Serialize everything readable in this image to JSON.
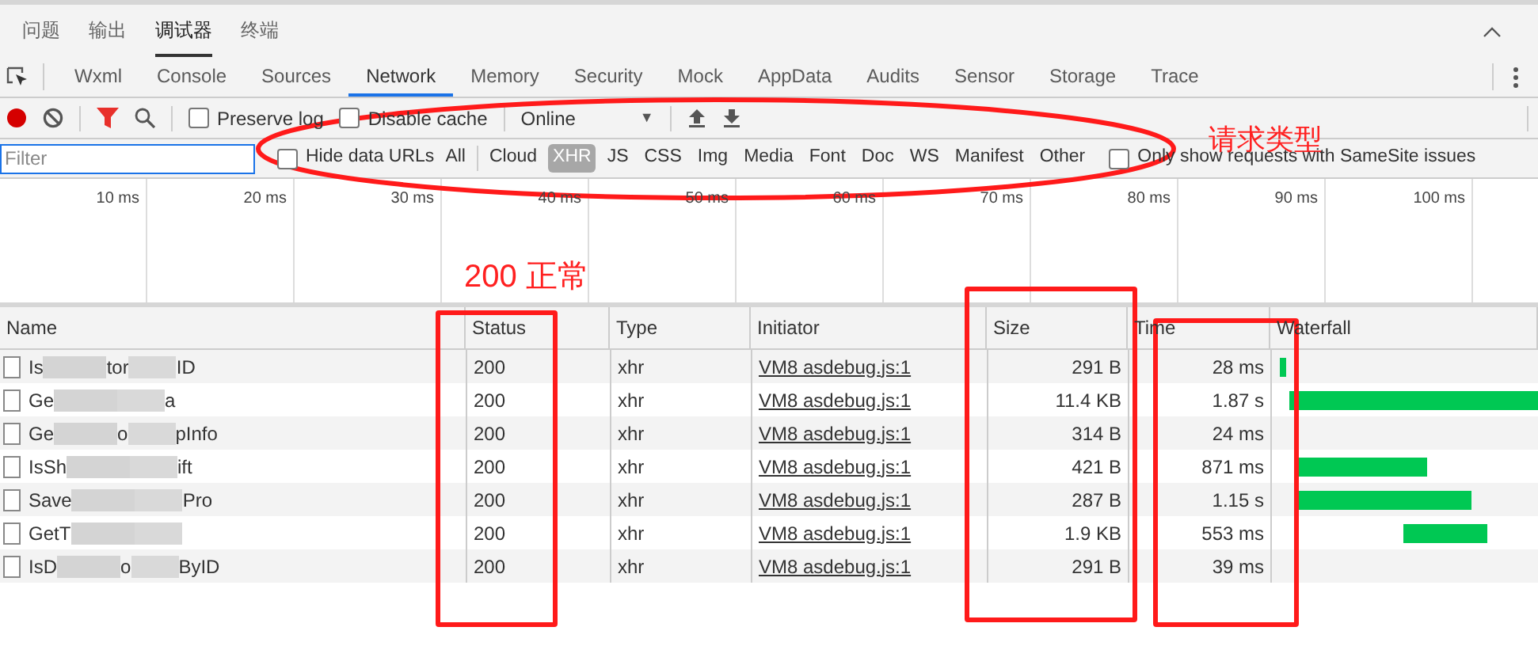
{
  "panel_tabs": [
    {
      "label": "问题",
      "selected": false
    },
    {
      "label": "输出",
      "selected": false
    },
    {
      "label": "调试器",
      "selected": true
    },
    {
      "label": "终端",
      "selected": false
    }
  ],
  "devtools_tabs": [
    {
      "label": "Wxml",
      "selected": false
    },
    {
      "label": "Console",
      "selected": false
    },
    {
      "label": "Sources",
      "selected": false
    },
    {
      "label": "Network",
      "selected": true
    },
    {
      "label": "Memory",
      "selected": false
    },
    {
      "label": "Security",
      "selected": false
    },
    {
      "label": "Mock",
      "selected": false
    },
    {
      "label": "AppData",
      "selected": false
    },
    {
      "label": "Audits",
      "selected": false
    },
    {
      "label": "Sensor",
      "selected": false
    },
    {
      "label": "Storage",
      "selected": false
    },
    {
      "label": "Trace",
      "selected": false
    }
  ],
  "toolbar": {
    "preserve_log": {
      "label": "Preserve log",
      "checked": false
    },
    "disable_cache": {
      "label": "Disable cache",
      "checked": false
    },
    "throttling": "Online",
    "throttling_caret": "▼"
  },
  "filter_bar": {
    "placeholder": "Filter",
    "hide_data_urls": {
      "label": "Hide data URLs",
      "checked": false
    },
    "types": [
      {
        "label": "All",
        "selected": false
      },
      {
        "label": "Cloud",
        "selected": false
      },
      {
        "label": "XHR",
        "selected": true
      },
      {
        "label": "JS",
        "selected": false
      },
      {
        "label": "CSS",
        "selected": false
      },
      {
        "label": "Img",
        "selected": false
      },
      {
        "label": "Media",
        "selected": false
      },
      {
        "label": "Font",
        "selected": false
      },
      {
        "label": "Doc",
        "selected": false
      },
      {
        "label": "WS",
        "selected": false
      },
      {
        "label": "Manifest",
        "selected": false
      },
      {
        "label": "Other",
        "selected": false
      }
    ],
    "samesite": {
      "label": "Only show requests with SameSite issues",
      "checked": false
    }
  },
  "overview_ticks": [
    "10 ms",
    "20 ms",
    "30 ms",
    "40 ms",
    "50 ms",
    "60 ms",
    "70 ms",
    "80 ms",
    "90 ms",
    "100 ms"
  ],
  "table": {
    "columns": [
      "Name",
      "Status",
      "Type",
      "Initiator",
      "Size",
      "Time",
      "Waterfall"
    ],
    "rows": [
      {
        "name_start": "Is",
        "name_end": "tor",
        "name_tail": "ID",
        "status": "200",
        "type": "xhr",
        "initiator": "VM8 asdebug.js:1",
        "size": "291 B",
        "time": "28 ms"
      },
      {
        "name_start": "Ge",
        "name_end": "",
        "name_tail": "a",
        "status": "200",
        "type": "xhr",
        "initiator": "VM8 asdebug.js:1",
        "size": "11.4 KB",
        "time": "1.87 s"
      },
      {
        "name_start": "Ge",
        "name_end": "o",
        "name_tail": "pInfo",
        "status": "200",
        "type": "xhr",
        "initiator": "VM8 asdebug.js:1",
        "size": "314 B",
        "time": "24 ms"
      },
      {
        "name_start": "IsSh",
        "name_end": "",
        "name_tail": "ift",
        "status": "200",
        "type": "xhr",
        "initiator": "VM8 asdebug.js:1",
        "size": "421 B",
        "time": "871 ms"
      },
      {
        "name_start": "Save",
        "name_end": "",
        "name_tail": "Pro",
        "status": "200",
        "type": "xhr",
        "initiator": "VM8 asdebug.js:1",
        "size": "287 B",
        "time": "1.15 s"
      },
      {
        "name_start": "GetT",
        "name_end": "",
        "name_tail": "",
        "status": "200",
        "type": "xhr",
        "initiator": "VM8 asdebug.js:1",
        "size": "1.9 KB",
        "time": "553 ms"
      },
      {
        "name_start": "IsD",
        "name_end": "o",
        "name_tail": "ByID",
        "status": "200",
        "type": "xhr",
        "initiator": "VM8 asdebug.js:1",
        "size": "291 B",
        "time": "39 ms"
      }
    ]
  },
  "annotations": {
    "filter_note": "请求类型",
    "status_note": "200 正常"
  }
}
